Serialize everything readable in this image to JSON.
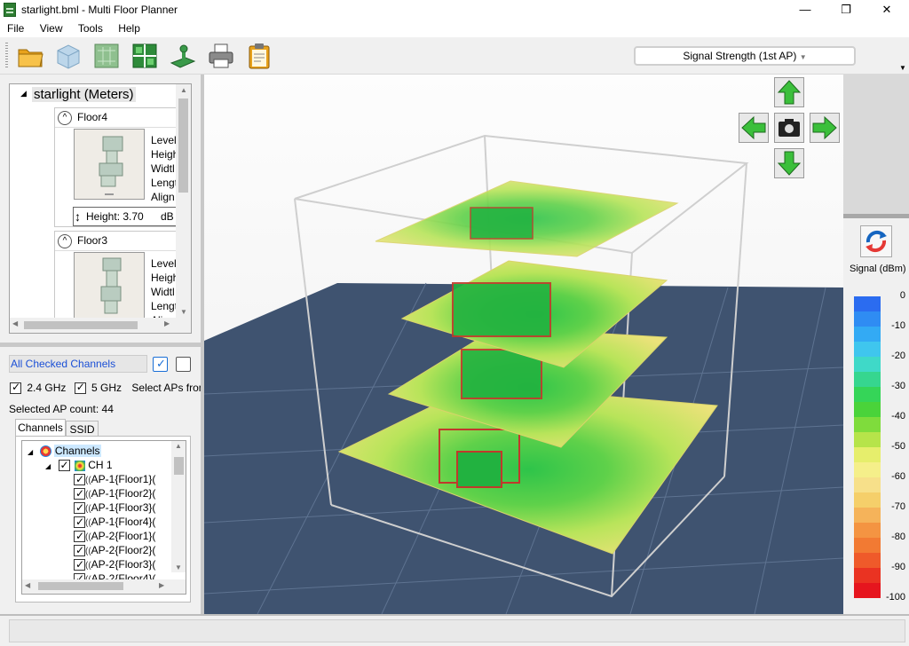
{
  "window": {
    "title": "starlight.bml - Multi Floor Planner",
    "min_glyph": "—",
    "max_glyph": "❐",
    "close_glyph": "✕"
  },
  "menu": [
    "File",
    "View",
    "Tools",
    "Help"
  ],
  "toolbar": {
    "icons": [
      "open-folder-icon",
      "3d-box-icon",
      "floor-plan-icon",
      "grid-icon",
      "signal-survey-icon",
      "printer-icon",
      "clipboard-icon"
    ],
    "view_select": "Signal Strength (1st AP)",
    "overflow_glyph": "▼"
  },
  "floor_tree": {
    "root_label": "starlight (Meters)",
    "floors": [
      {
        "name": "Floor4",
        "props": [
          "Level",
          "Heigh",
          "Widtl",
          "Lengt",
          "Align"
        ],
        "height_label": "Height: 3.70",
        "unit": "dB"
      },
      {
        "name": "Floor3",
        "props": [
          "Level",
          "Heigh",
          "Widtl",
          "Lengt",
          "Align"
        ]
      }
    ]
  },
  "channels": {
    "filter_label": "All Checked Channels",
    "band_24": "2.4 GHz",
    "band_5": "5 GHz",
    "select_aps": "Select APs fron",
    "ap_count": "Selected AP count: 44",
    "tabs": [
      "Channels",
      "SSID"
    ],
    "tree_root": "Channels",
    "channel": "CH 1",
    "aps": [
      "AP-1{Floor1}(",
      "AP-1{Floor2}(",
      "AP-1{Floor3}(",
      "AP-1{Floor4}(",
      "AP-2{Floor1}(",
      "AP-2{Floor2}(",
      "AP-2{Floor3}(",
      "AP-2{Floor4}("
    ]
  },
  "legend": {
    "title": "Signal (dBm)",
    "ticks": [
      "0",
      "-10",
      "-20",
      "-30",
      "-40",
      "-50",
      "-60",
      "-70",
      "-80",
      "-90",
      "-100"
    ],
    "colors": [
      "#2b6cf0",
      "#2f8cf3",
      "#33aaf4",
      "#3fc6ee",
      "#3fd9c8",
      "#36d68f",
      "#35d558",
      "#4ad33a",
      "#7fdc3c",
      "#b6e44a",
      "#e6ee6c",
      "#f5ef8a",
      "#f7e08a",
      "#f5cf6a",
      "#f5b35a",
      "#f49442",
      "#f27a33",
      "#ef5a2a",
      "#ea3322",
      "#e6151e"
    ]
  },
  "nav": {
    "up": "up-arrow-icon",
    "left": "left-arrow-icon",
    "right": "right-arrow-icon",
    "down": "down-arrow-icon",
    "snapshot": "camera-icon"
  }
}
